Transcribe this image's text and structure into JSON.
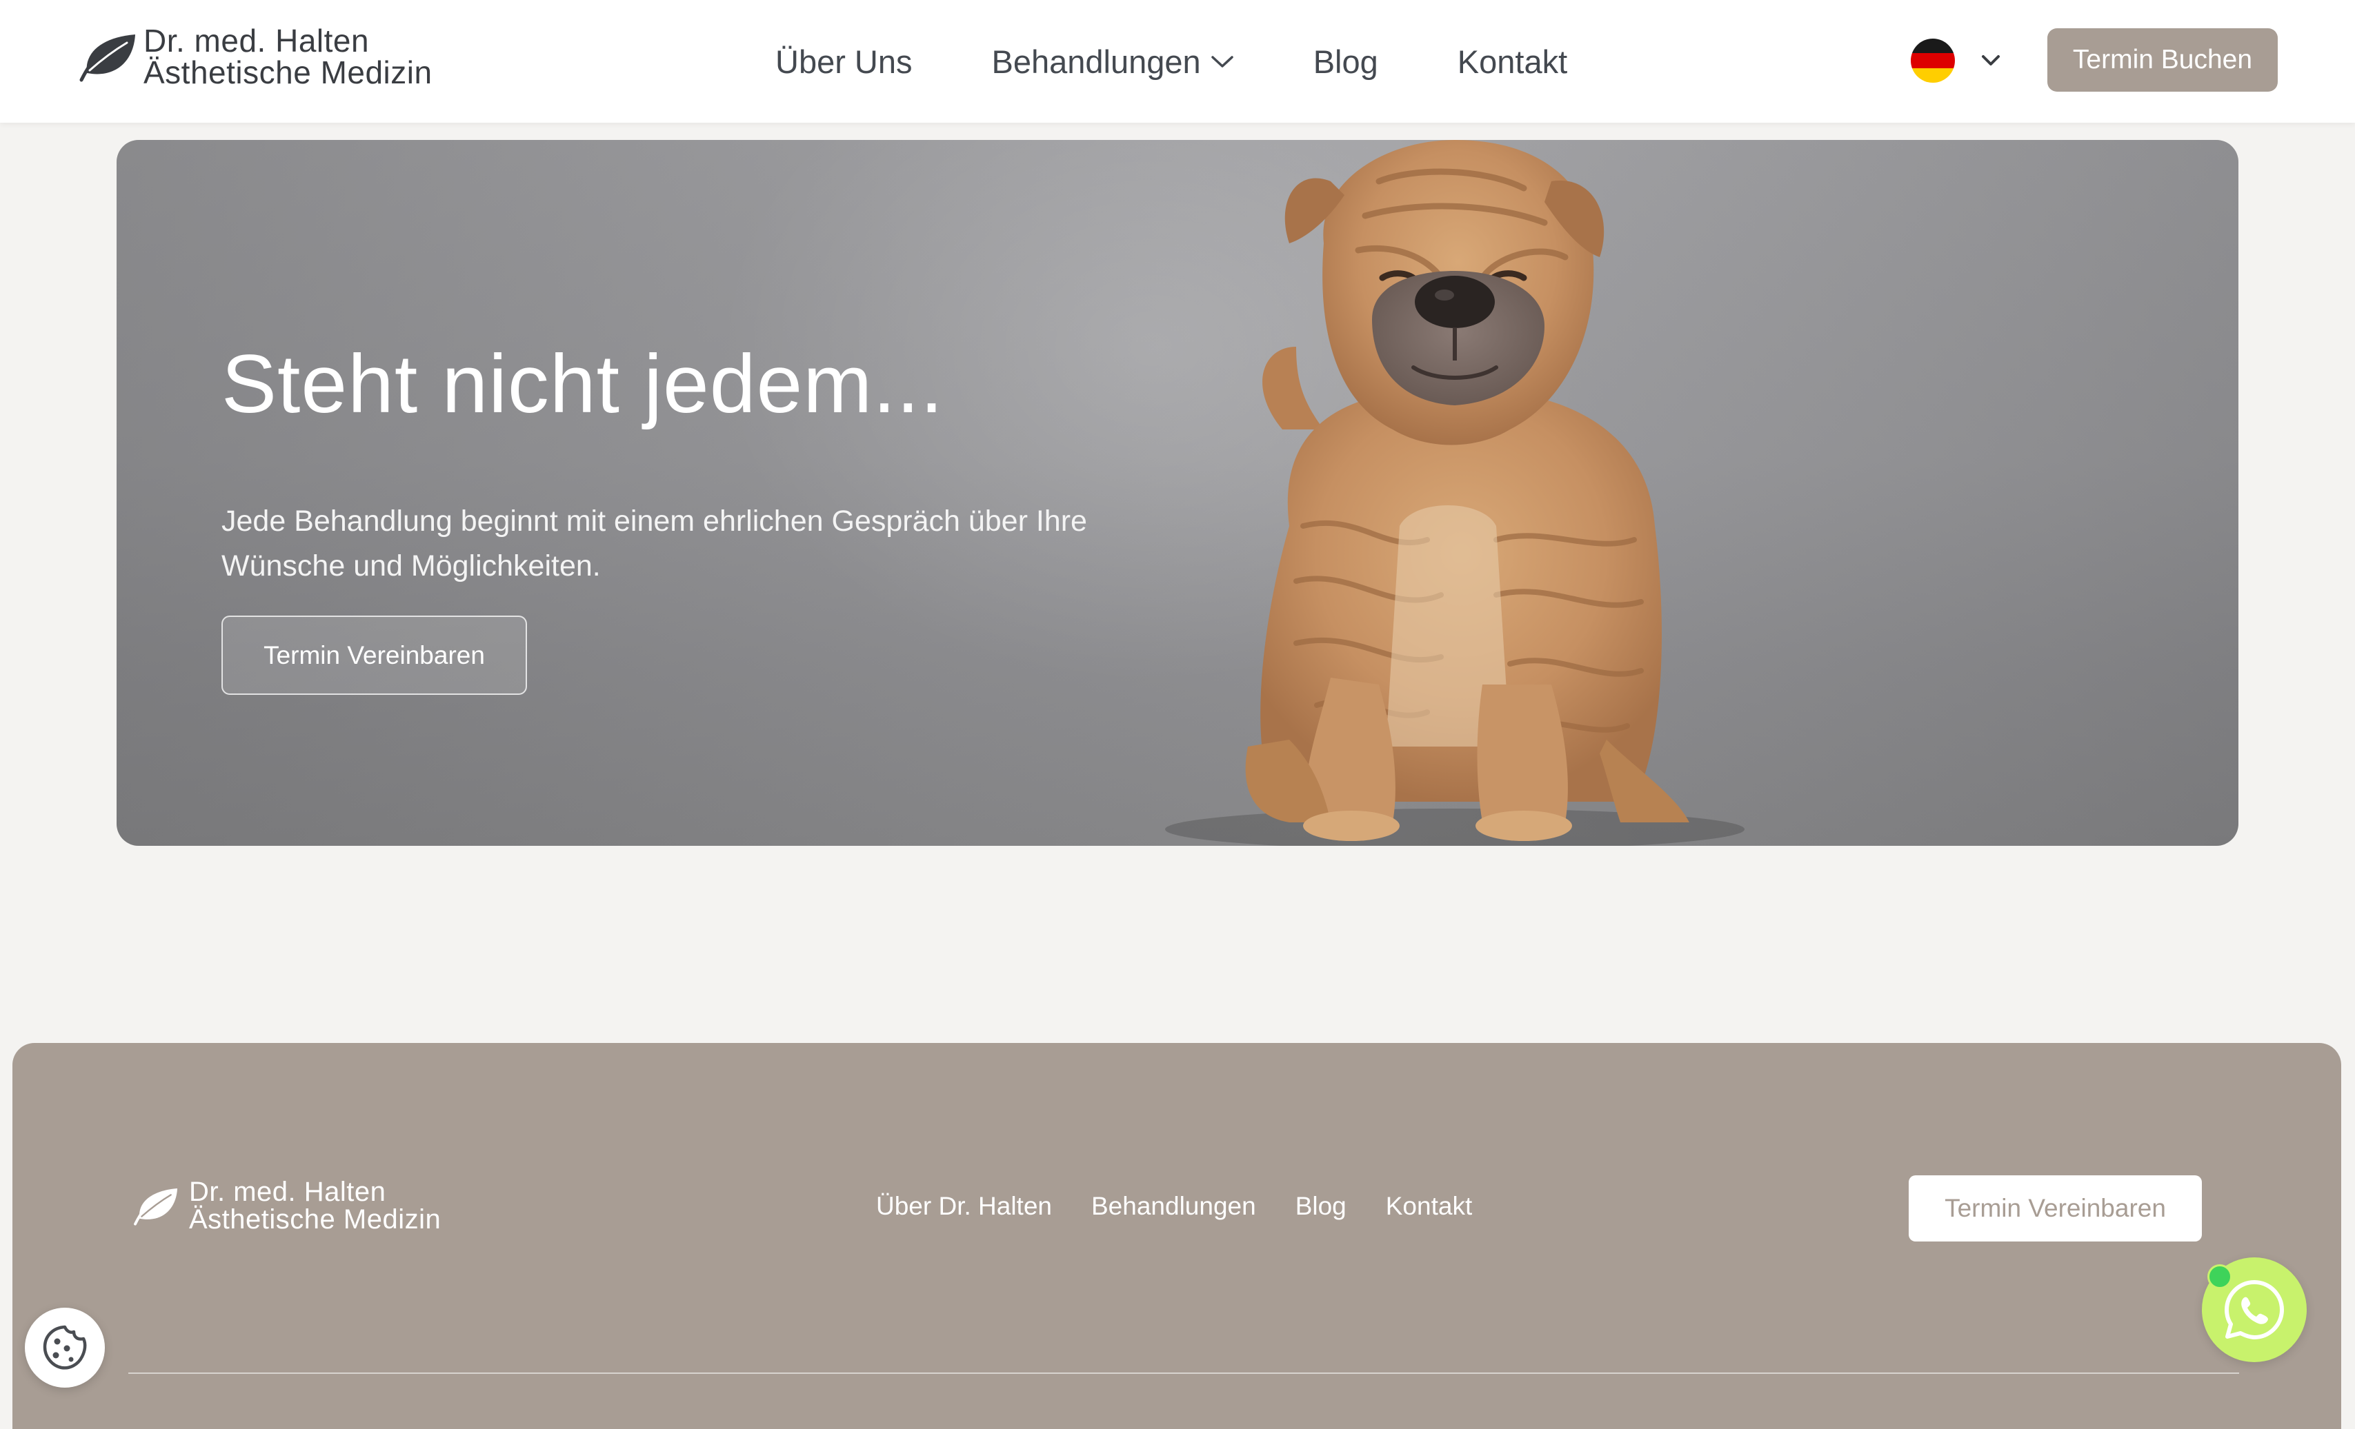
{
  "header": {
    "logo_line1": "Dr. med. Halten",
    "logo_line2": "Ästhetische Medizin",
    "nav": [
      {
        "label": "Über Uns"
      },
      {
        "label": "Behandlungen",
        "has_dropdown": true
      },
      {
        "label": "Blog"
      },
      {
        "label": "Kontakt"
      }
    ],
    "language": "de",
    "book_button": "Termin Buchen"
  },
  "hero": {
    "title": "Steht nicht jedem...",
    "subtitle": "Jede Behandlung beginnt mit einem ehrlichen Gespräch über Ihre Wünsche und Möglichkeiten.",
    "button": "Termin Vereinbaren"
  },
  "footer": {
    "logo_line1": "Dr. med. Halten",
    "logo_line2": "Ästhetische Medizin",
    "nav": [
      {
        "label": "Über Dr. Halten"
      },
      {
        "label": "Behandlungen"
      },
      {
        "label": "Blog"
      },
      {
        "label": "Kontakt"
      }
    ],
    "button": "Termin Vereinbaren"
  },
  "floating": {
    "cookie_icon": "cookie-icon",
    "whatsapp_icon": "whatsapp-icon"
  },
  "colors": {
    "accent": "#a89d94",
    "text_dark": "#3a3d42",
    "page_bg": "#f4f3f1",
    "whatsapp_bg": "#c8f26c"
  }
}
